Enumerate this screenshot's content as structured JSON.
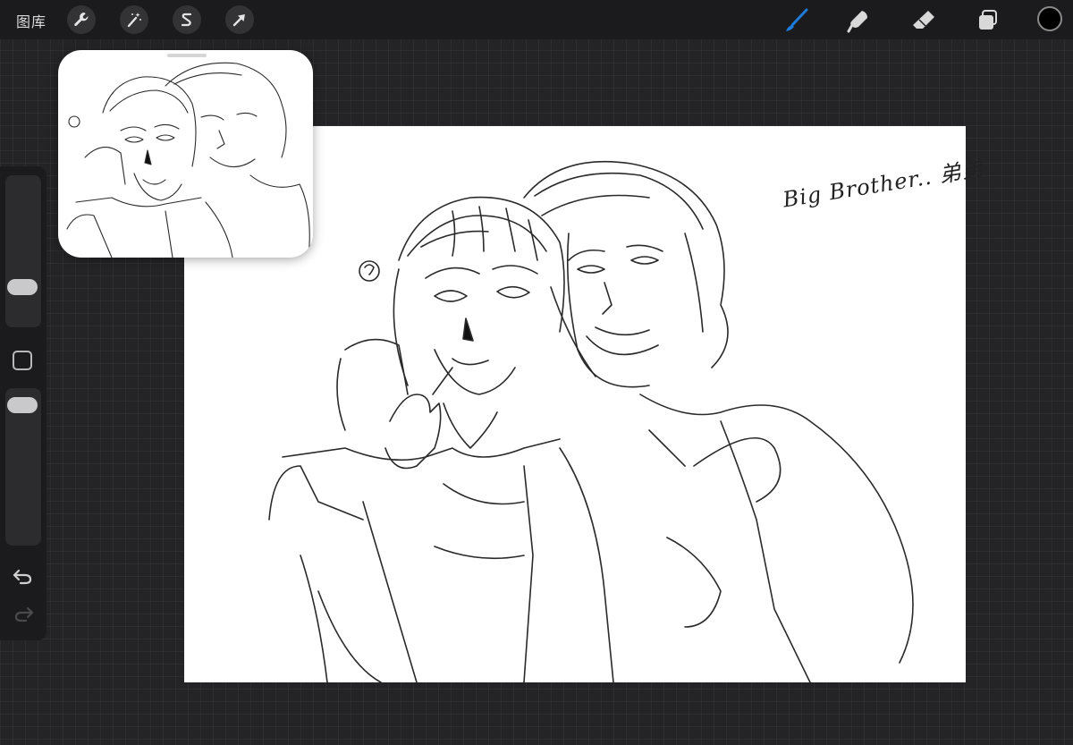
{
  "topbar": {
    "gallery_label": "图库",
    "left_tools": [
      {
        "name": "actions",
        "icon": "wrench-icon"
      },
      {
        "name": "adjustments",
        "icon": "magic-wand-icon"
      },
      {
        "name": "selection",
        "icon": "selection-s-icon"
      },
      {
        "name": "transform",
        "icon": "arrow-cursor-icon"
      }
    ],
    "right_tools": [
      {
        "name": "brush",
        "icon": "brush-icon",
        "active": true
      },
      {
        "name": "smudge",
        "icon": "smudge-icon"
      },
      {
        "name": "eraser",
        "icon": "eraser-icon"
      },
      {
        "name": "layers",
        "icon": "layers-icon"
      }
    ],
    "current_color": "#000000",
    "active_tool_color": "#1e7bd8"
  },
  "sidebar": {
    "controls": [
      "brush-size-slider",
      "modify-button",
      "opacity-slider",
      "undo-icon",
      "redo-icon"
    ]
  },
  "canvas": {
    "handwritten_text": "Big Brother.. 弟弟"
  },
  "reference_window": {
    "content": "reference-sketch-thumbnail"
  }
}
